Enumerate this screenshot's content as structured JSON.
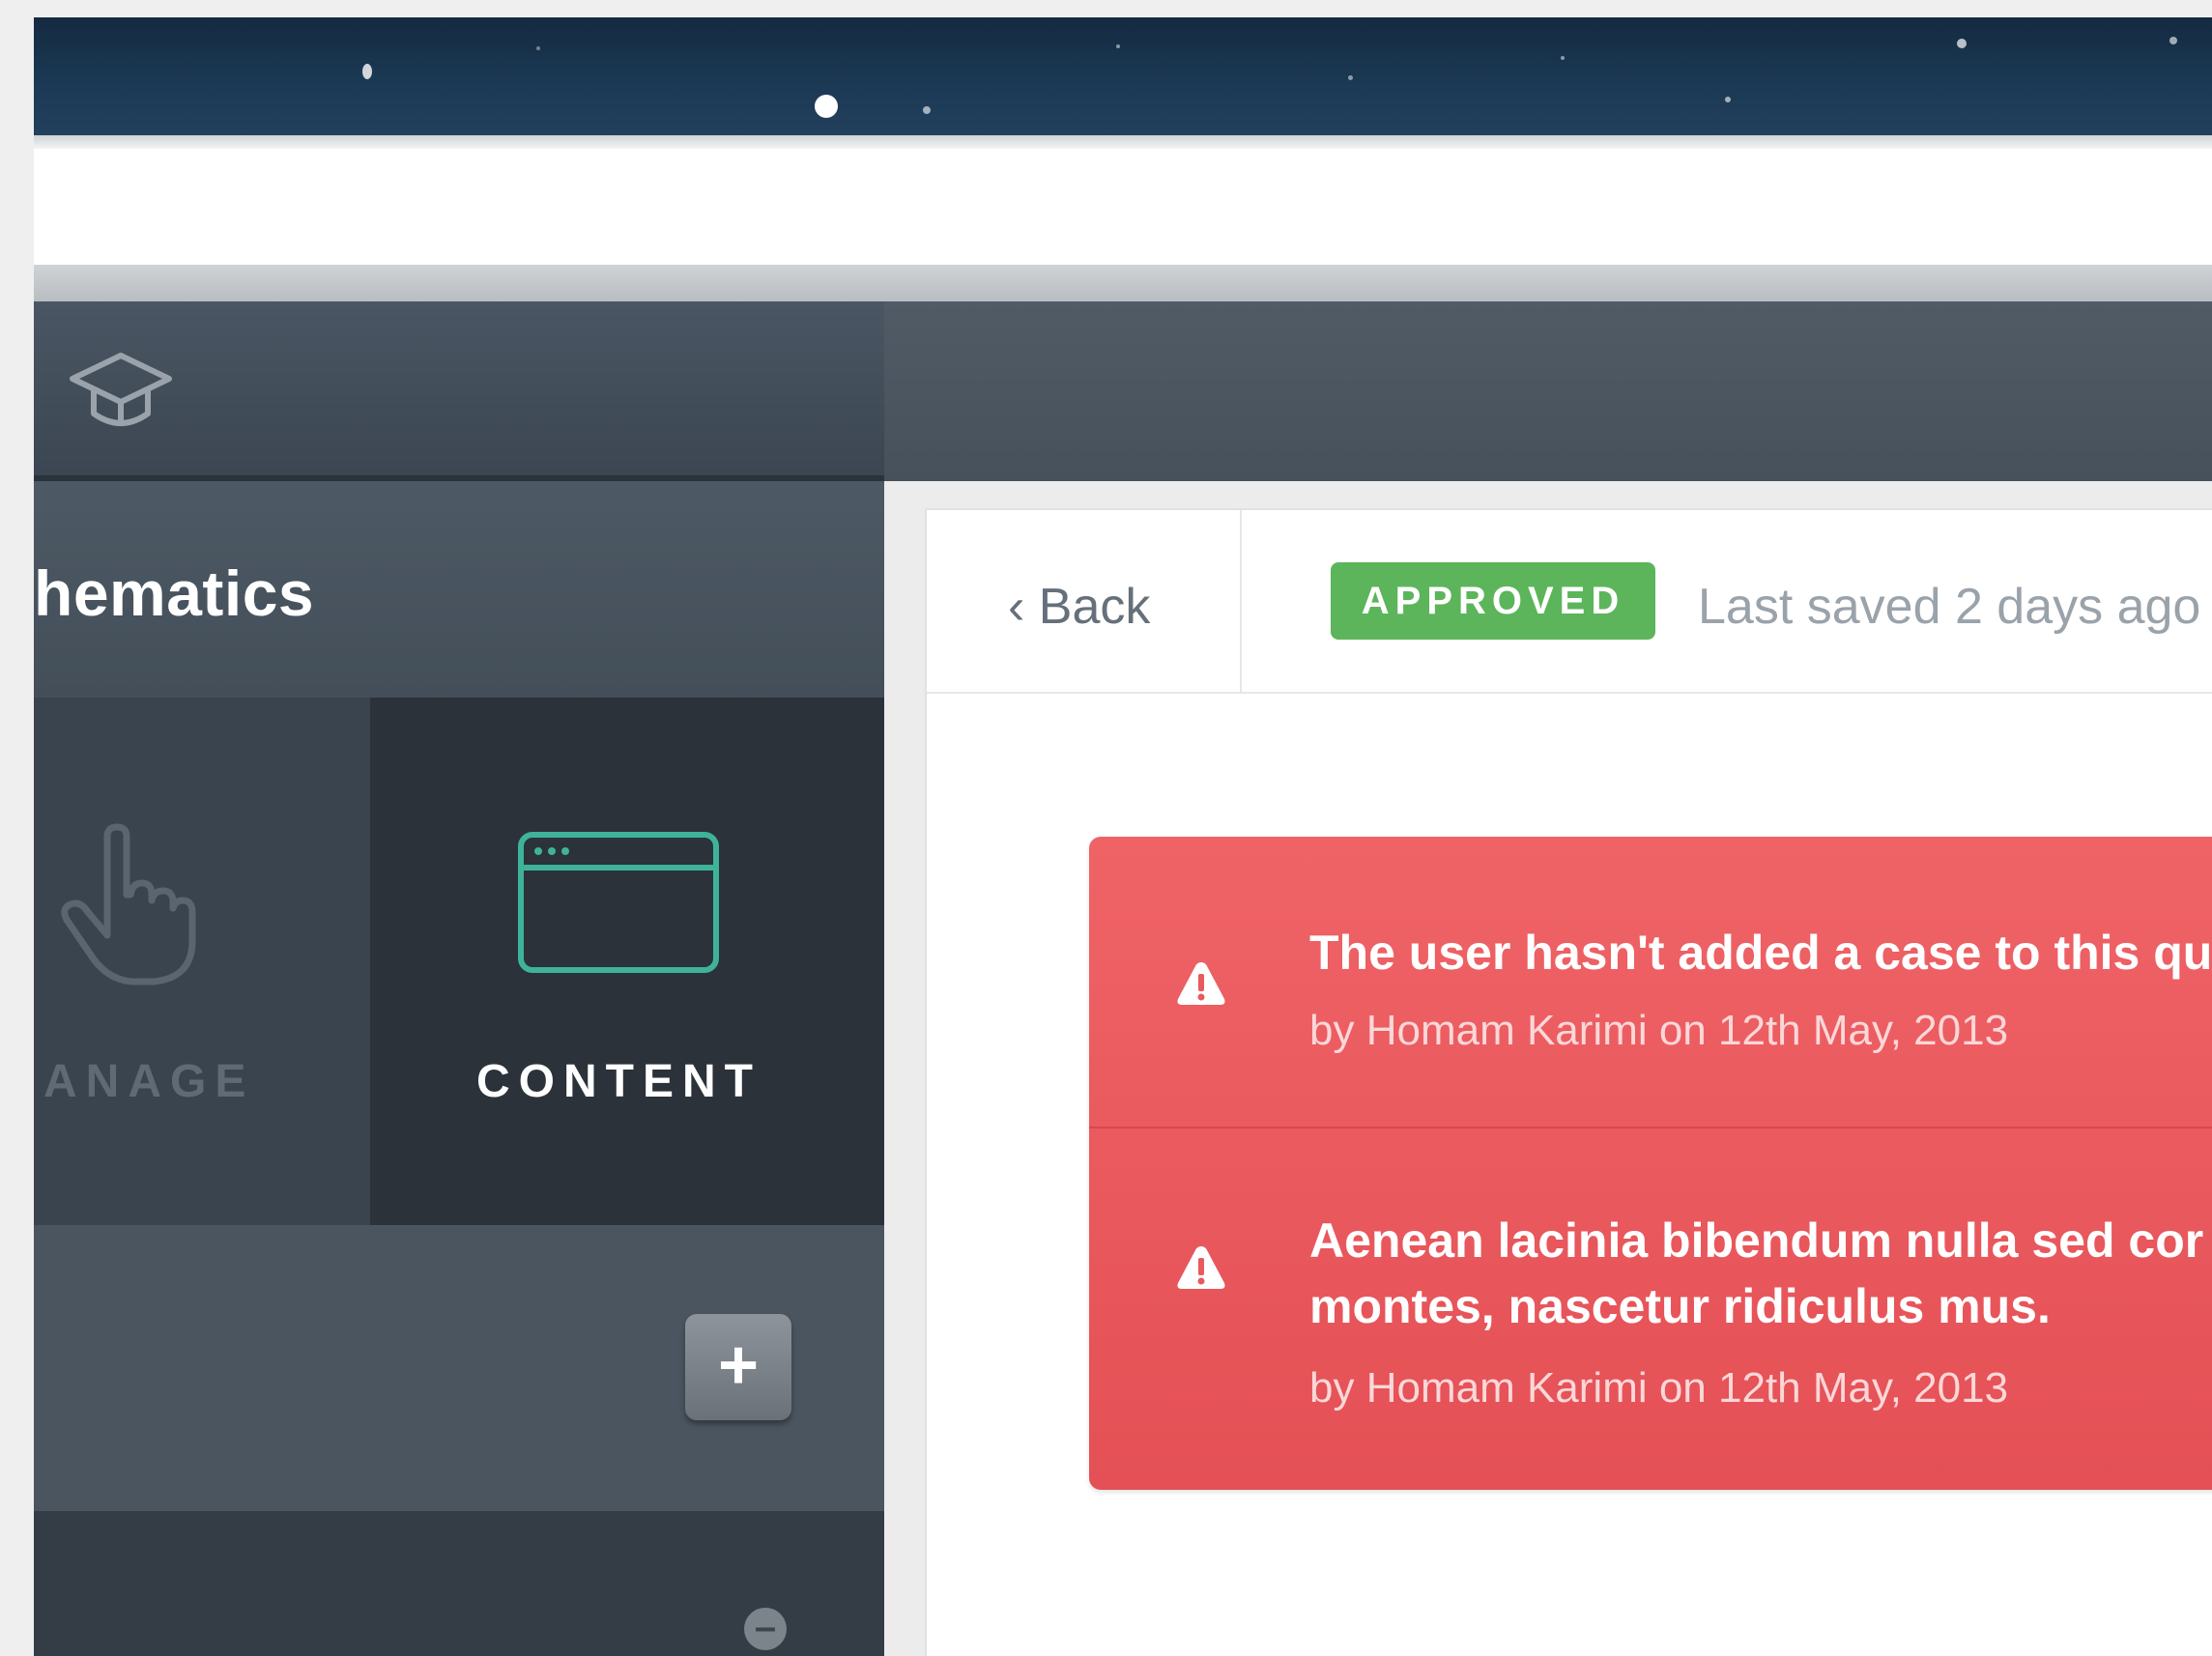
{
  "sidebar": {
    "course_title": "hematics",
    "tabs": [
      {
        "label": "ANAGE",
        "icon": "hand-pointer-icon",
        "active": false
      },
      {
        "label": "CONTENT",
        "icon": "browser-window-icon",
        "active": true
      }
    ],
    "add_button_label": "+",
    "accent_color": "#3fb39a"
  },
  "header": {
    "logo_icon": "graduation-cap-icon"
  },
  "toolbar": {
    "back_label": "‹ Back",
    "status_badge": "APPROVED",
    "status_color": "#5cb55a",
    "saved_text": "Last saved 2 days ago"
  },
  "alerts": {
    "color": "#e85a5e",
    "items": [
      {
        "message": "The user hasn't added a case to this qu",
        "meta": "by Homam Karimi on 12th May, 2013"
      },
      {
        "message_line1": "Aenean lacinia bibendum nulla sed cor",
        "message_line2": "montes, nascetur ridiculus mus.",
        "meta": "by Homam Karimi on 12th May, 2013"
      }
    ]
  }
}
